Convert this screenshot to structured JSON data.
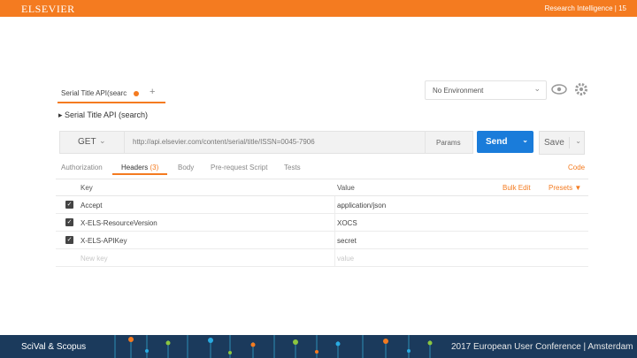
{
  "header": {
    "logo_text": "ELSEVIER",
    "right_text": "Research Intelligence | 15",
    "bg_color": "#f47b20"
  },
  "request_tab": {
    "label": "Serial Title API(searc",
    "unsaved_dot_color": "#f47b20",
    "new_tab_label": "+"
  },
  "environment": {
    "selected": "No Environment",
    "chevron_icon": "chevron-down-icon",
    "eye_icon": "eye-icon",
    "settings_icon": "gear-icon"
  },
  "collection_path": "▸ Serial Title API (search)",
  "request": {
    "method": "GET",
    "url": "http://api.elsevier.com/content/serial/title/ISSN=0045-7906",
    "params_label": "Params",
    "send_label": "Send",
    "save_label": "Save"
  },
  "subtabs": {
    "authorization": "Authorization",
    "headers": "Headers",
    "headers_count": "(3)",
    "body": "Body",
    "prerequest": "Pre-request Script",
    "tests": "Tests",
    "code": "Code"
  },
  "headers_table": {
    "col_key": "Key",
    "col_value": "Value",
    "bulk_edit": "Bulk Edit",
    "presets": "Presets ▼",
    "rows": [
      {
        "key": "Accept",
        "value": "application/json"
      },
      {
        "key": "X-ELS-ResourceVersion",
        "value": "XOCS"
      },
      {
        "key": "X-ELS-APIKey",
        "value": "secret"
      }
    ],
    "placeholder_key": "New key",
    "placeholder_value": "value"
  },
  "footer": {
    "brand": "SciVal & Scopus",
    "conference": "2017 European User Conference | Amsterdam",
    "bg_color": "#1b3a5c"
  }
}
